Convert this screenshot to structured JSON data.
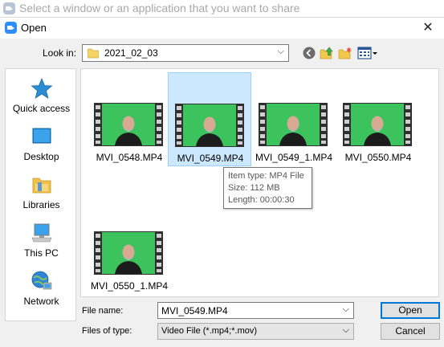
{
  "share_bar": {
    "text": "Select a window or an application that you want to share"
  },
  "dialog": {
    "title": "Open",
    "close_glyph": "✕"
  },
  "lookin": {
    "label": "Look in:",
    "value": "2021_02_03",
    "chevron": "⌵"
  },
  "toolbar_icons": [
    "back-icon",
    "up-folder-icon",
    "new-folder-icon",
    "view-menu-icon"
  ],
  "places": [
    {
      "label": "Quick access",
      "icon": "star-icon"
    },
    {
      "label": "Desktop",
      "icon": "desktop-icon"
    },
    {
      "label": "Libraries",
      "icon": "libraries-icon"
    },
    {
      "label": "This PC",
      "icon": "this-pc-icon"
    },
    {
      "label": "Network",
      "icon": "network-icon"
    }
  ],
  "files": [
    {
      "name": "MVI_0548.MP4",
      "selected": false
    },
    {
      "name": "MVI_0549.MP4",
      "selected": true
    },
    {
      "name": "MVI_0549_1.MP4",
      "selected": false
    },
    {
      "name": "MVI_0550.MP4",
      "selected": false
    },
    {
      "name": "MVI_0550_1.MP4",
      "selected": false
    }
  ],
  "tooltip": {
    "type": "Item type: MP4 File",
    "size": "Size: 112 MB",
    "length": "Length: 00:00:30"
  },
  "filename": {
    "label": "File name:",
    "value": "MVI_0549.MP4",
    "chevron": "⌵"
  },
  "filetype": {
    "label": "Files of type:",
    "value": "Video File (*.mp4;*.mov)",
    "chevron": "⌵"
  },
  "buttons": {
    "open": "Open",
    "cancel": "Cancel"
  },
  "colors": {
    "selection": "#cce8ff",
    "selection_border": "#99d1ff",
    "green_screen": "#3dc35e",
    "accent": "#0078d7"
  }
}
